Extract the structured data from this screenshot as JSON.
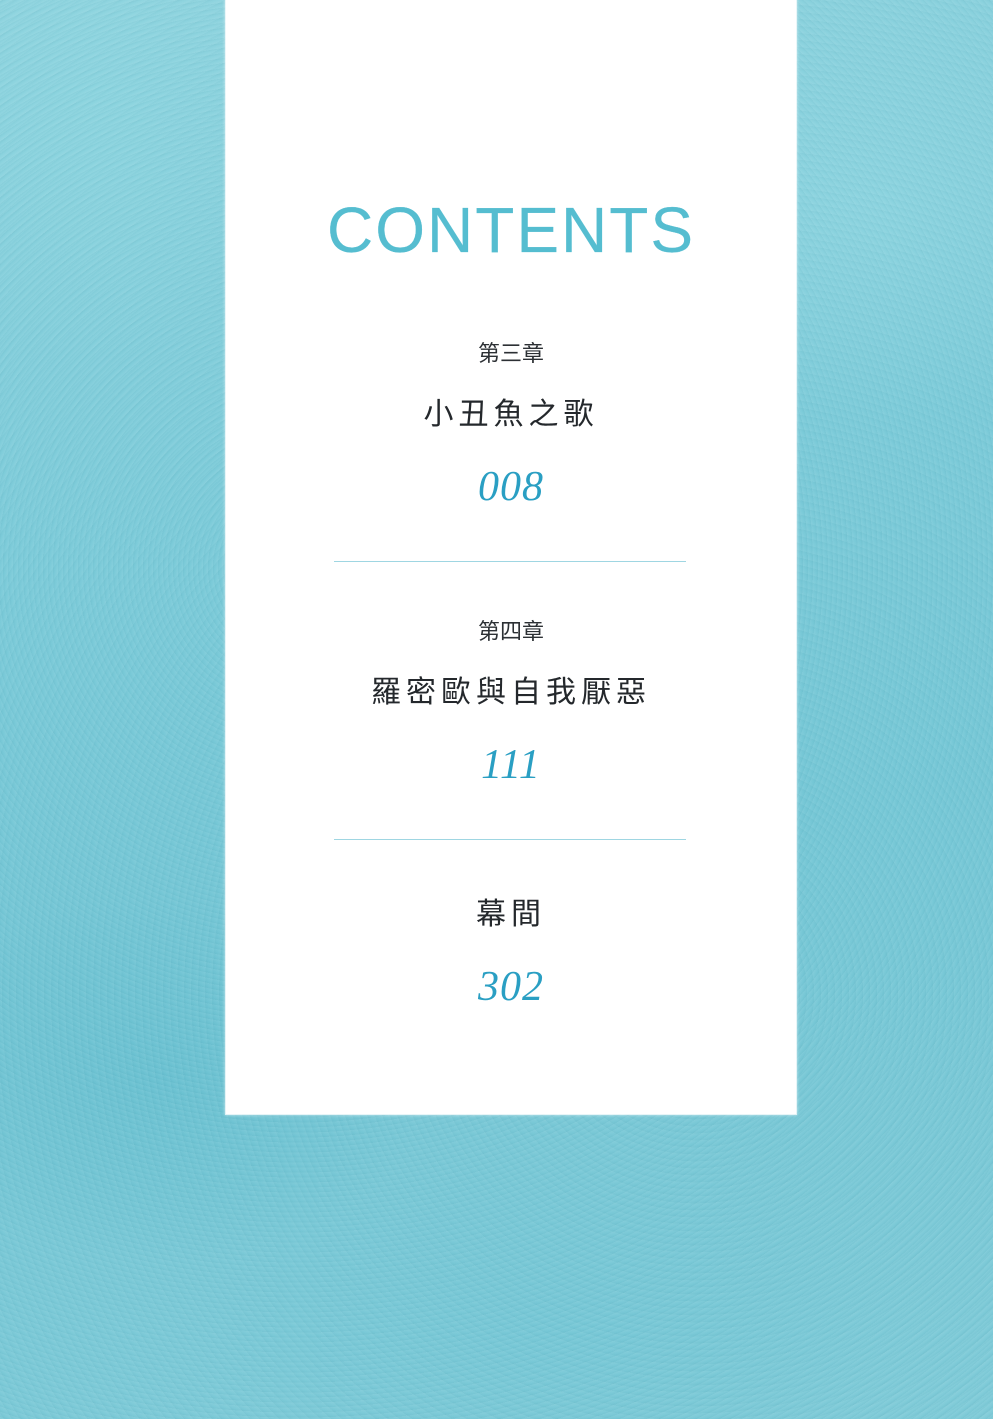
{
  "heading": "CONTENTS",
  "entries": [
    {
      "label": "第三章",
      "title": "小丑魚之歌",
      "page": "008"
    },
    {
      "label": "第四章",
      "title": "羅密歐與自我厭惡",
      "page": "111"
    },
    {
      "label": "",
      "title": "幕間",
      "page": "302"
    }
  ],
  "colors": {
    "background": "#7ccbd9",
    "heading": "#55bdd0",
    "page_number": "#2a9fc3",
    "divider": "#9fd6e2"
  }
}
